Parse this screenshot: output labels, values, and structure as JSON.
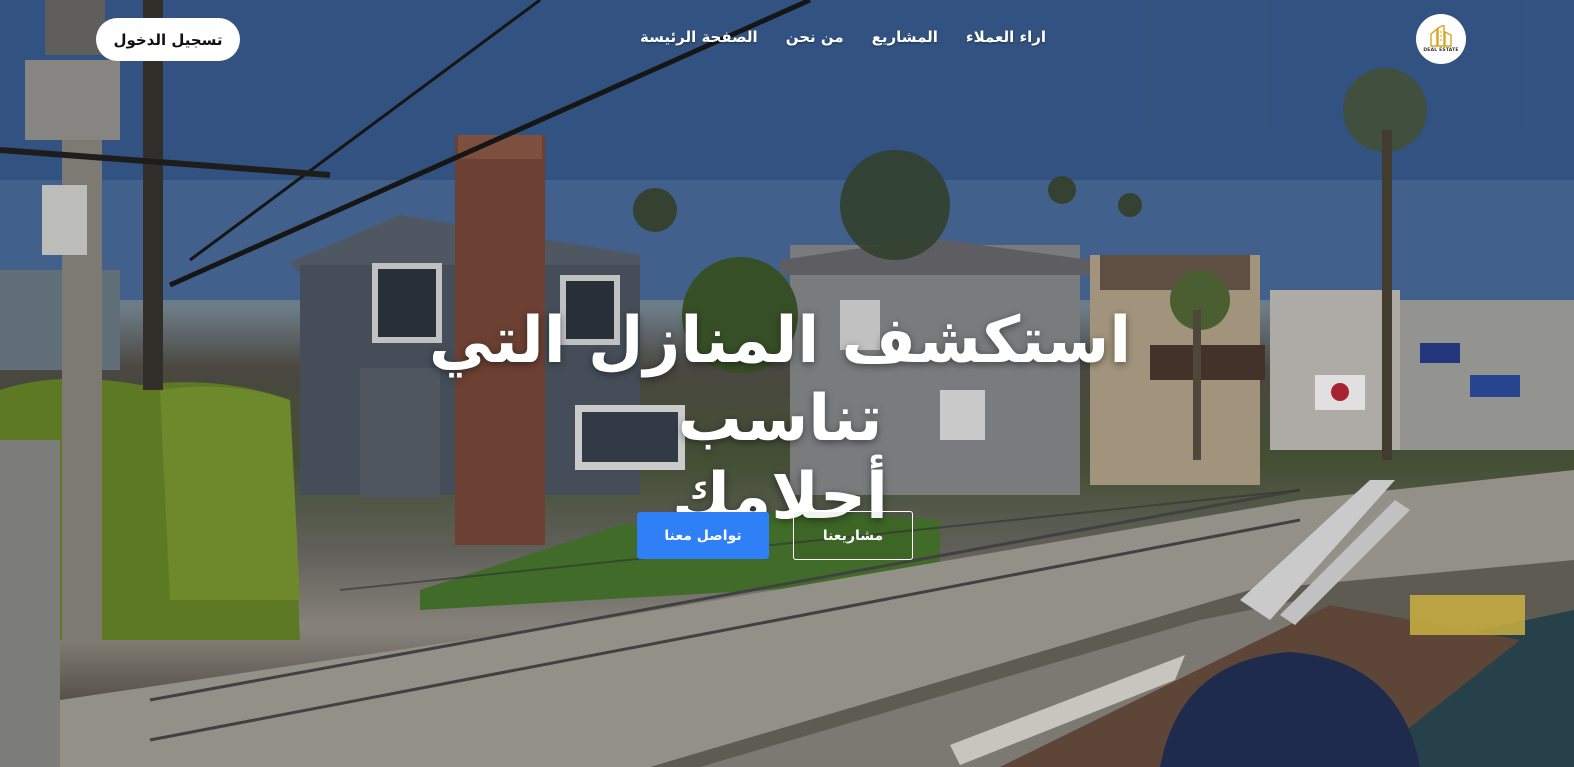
{
  "header": {
    "login_label": "تسجيل الدخول",
    "nav": [
      {
        "label": "الصفحة الرئيسة"
      },
      {
        "label": "من نحن"
      },
      {
        "label": "المشاريع"
      },
      {
        "label": "اراء العملاء"
      }
    ],
    "logo_text": "DEAL ESTATE",
    "logo_icon": "building-logo-icon"
  },
  "hero": {
    "headline_line1": "استكشف المنازل التي تناسب",
    "headline_line2": "أحلامك",
    "contact_button": "تواصل معنا",
    "projects_button": "مشاريعنا"
  },
  "colors": {
    "accent": "#2f7ff7",
    "logo_gold": "#d9a521",
    "text_on_image": "#ffffff"
  }
}
